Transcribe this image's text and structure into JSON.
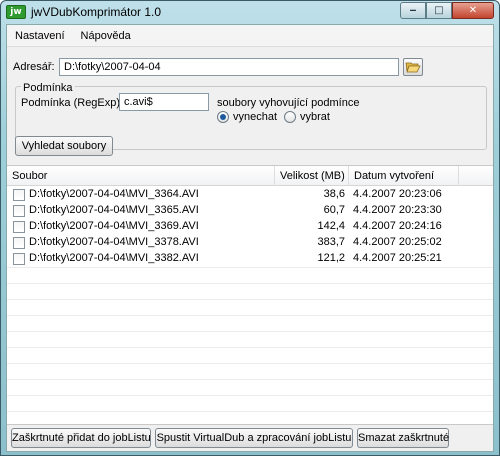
{
  "window": {
    "app_icon_text": "jw",
    "title": "jwVDubKomprimátor 1.0",
    "minimize": "‒",
    "maximize": "□",
    "close": "✕"
  },
  "menu": {
    "items": [
      {
        "label": "Nastavení"
      },
      {
        "label": "Nápověda"
      }
    ]
  },
  "directory": {
    "label": "Adresář:",
    "value": "D:\\fotky\\2007-04-04"
  },
  "condition": {
    "group_title": "Podmínka",
    "label": "Podmínka (RegExp):",
    "value": "c.avi$",
    "matching_label": "soubory vyhovující podmínce",
    "options": [
      {
        "label": "vynechat",
        "selected": true
      },
      {
        "label": "vybrat",
        "selected": false
      }
    ]
  },
  "search_button": "Vyhledat soubory",
  "files": {
    "columns": {
      "name": "Soubor",
      "size": "Velikost (MB)",
      "date": "Datum vytvoření"
    },
    "rows": [
      {
        "name": "D:\\fotky\\2007-04-04\\MVI_3364.AVI",
        "size": "38,6",
        "date": "4.4.2007 20:23:06"
      },
      {
        "name": "D:\\fotky\\2007-04-04\\MVI_3365.AVI",
        "size": "60,7",
        "date": "4.4.2007 20:23:30"
      },
      {
        "name": "D:\\fotky\\2007-04-04\\MVI_3369.AVI",
        "size": "142,4",
        "date": "4.4.2007 20:24:16"
      },
      {
        "name": "D:\\fotky\\2007-04-04\\MVI_3378.AVI",
        "size": "383,7",
        "date": "4.4.2007 20:25:02"
      },
      {
        "name": "D:\\fotky\\2007-04-04\\MVI_3382.AVI",
        "size": "121,2",
        "date": "4.4.2007 20:25:21"
      }
    ]
  },
  "actions": {
    "add_to_joblist": "Zaškrtnuté přidat do jobListu",
    "run_virtualdub": "Spustit VirtualDub a zpracování jobListu",
    "delete_checked": "Smazat zaškrtnuté"
  }
}
